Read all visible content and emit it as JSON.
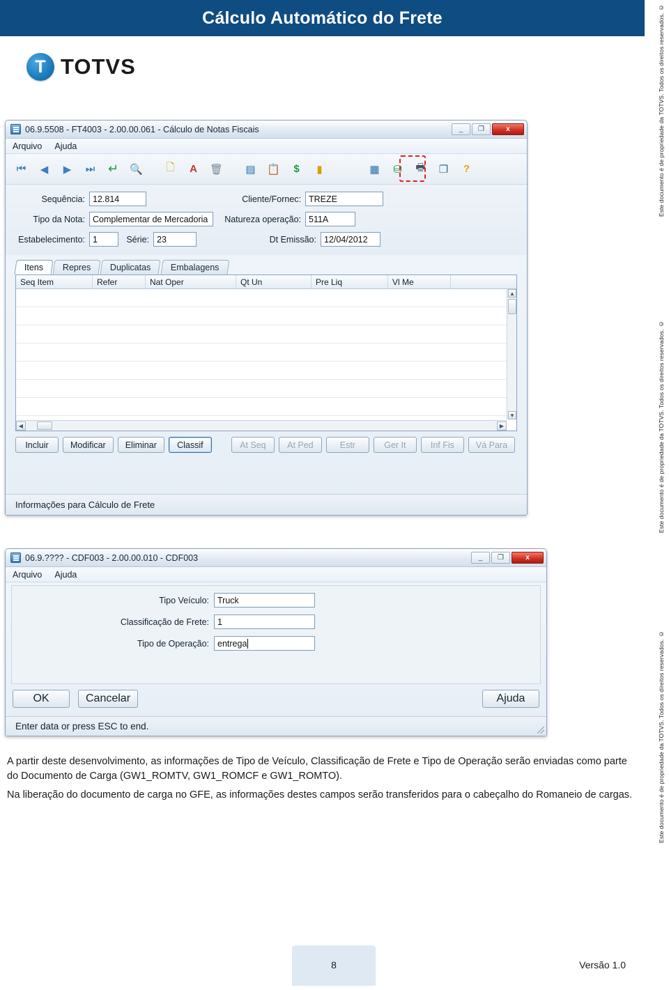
{
  "page": {
    "banner_title": "Cálculo Automático do Frete",
    "banner_color": "#0f4c81",
    "logo_text": "TOTVS",
    "logo_icon": "totvs-t-logo-icon",
    "footer_page_number": "8",
    "footer_version": "Versão 1.0"
  },
  "side_notes": [
    "Este documento é de propriedade da TOTVS. Todos os direitos reservados. ©",
    "Este documento é de propriedade da TOTVS. Todos os direitos reservados. ©",
    "Este documento é de propriedade da TOTVS. Todos os direitos reservados. ©"
  ],
  "window_nf": {
    "title": "06.9.5508 - FT4003 - 2.00.00.061 - Cálculo de Notas Fiscais",
    "window_icon": "application-icon",
    "buttons": {
      "minimize": "_",
      "maximize": "❐",
      "close": "x"
    },
    "menu": [
      "Arquivo",
      "Ajuda"
    ],
    "toolbar": [
      {
        "name": "first-record-button",
        "glyph": "⏮"
      },
      {
        "name": "previous-record-button",
        "glyph": "◀"
      },
      {
        "name": "next-record-button",
        "glyph": "▶"
      },
      {
        "name": "last-record-button",
        "glyph": "⏭"
      },
      {
        "name": "enter-button",
        "glyph": "↵"
      },
      {
        "name": "search-button",
        "glyph": "🔍"
      },
      {
        "name": "new-document-button",
        "glyph": "🗋"
      },
      {
        "name": "text-edit-button",
        "glyph": "A"
      },
      {
        "name": "delete-button",
        "glyph": "🗑"
      },
      {
        "name": "report-button",
        "glyph": "▤"
      },
      {
        "name": "clipboard-button",
        "glyph": "📋"
      },
      {
        "name": "currency-button",
        "glyph": "$"
      },
      {
        "name": "book-button",
        "glyph": "▮"
      },
      {
        "name": "freight-calc-button",
        "glyph": "▦"
      },
      {
        "name": "tree-button",
        "glyph": "⛁"
      },
      {
        "name": "print-button",
        "glyph": "🖶"
      },
      {
        "name": "copy-button",
        "glyph": "❐"
      },
      {
        "name": "help-button",
        "glyph": "?"
      }
    ],
    "fields": [
      {
        "label": "Sequência:",
        "value": "12.814"
      },
      {
        "label": "Cliente/Fornec:",
        "value": "TREZE"
      },
      {
        "label": "Tipo da Nota:",
        "value": "Complementar de Mercadoria"
      },
      {
        "label": "Natureza operação:",
        "value": "511A"
      },
      {
        "label": "Estabelecimento:",
        "value": "1"
      },
      {
        "label": "Série:",
        "value": "23"
      },
      {
        "label": "Dt Emissão:",
        "value": "12/04/2012"
      }
    ],
    "tabs": [
      {
        "label": "Itens",
        "active": true
      },
      {
        "label": "Repres",
        "active": false
      },
      {
        "label": "Duplicatas",
        "active": false
      },
      {
        "label": "Embalagens",
        "active": false
      }
    ],
    "grid_columns": [
      "Seq Item",
      "Refer",
      "Nat Oper",
      "Qt Un",
      "Pre Liq",
      "Vl Me"
    ],
    "grid_rows": [],
    "action_buttons": [
      {
        "label": "Incluir",
        "state": "normal"
      },
      {
        "label": "Modificar",
        "state": "normal"
      },
      {
        "label": "Eliminar",
        "state": "normal"
      },
      {
        "label": "Classif",
        "state": "selected"
      },
      {
        "label": "At Seq",
        "state": "disabled"
      },
      {
        "label": "At Ped",
        "state": "disabled"
      },
      {
        "label": "Estr",
        "state": "disabled"
      },
      {
        "label": "Ger It",
        "state": "disabled"
      },
      {
        "label": "Inf Fis",
        "state": "disabled"
      },
      {
        "label": "Vá Para",
        "state": "disabled"
      }
    ],
    "status_text": "Informações para Cálculo de Frete"
  },
  "window_cdf": {
    "title": "06.9.???? - CDF003 - 2.00.00.010 - CDF003",
    "window_icon": "application-icon",
    "buttons": {
      "minimize": "_",
      "maximize": "❐",
      "close": "x"
    },
    "menu": [
      "Arquivo",
      "Ajuda"
    ],
    "fields": [
      {
        "label": "Tipo Veículo:",
        "value": "Truck"
      },
      {
        "label": "Classificação de Frete:",
        "value": "1"
      },
      {
        "label": "Tipo de Operação:",
        "value": "entrega"
      }
    ],
    "buttons_row": [
      {
        "name": "ok-button",
        "label": "OK"
      },
      {
        "name": "cancel-button",
        "label": "Cancelar"
      },
      {
        "name": "help-button",
        "label": "Ajuda"
      }
    ],
    "status_text": "Enter data or press ESC to end."
  },
  "body": {
    "paragraph1": "A partir deste desenvolvimento, as informações de Tipo de Veículo, Classificação de Frete e Tipo de Operação serão enviadas como parte do Documento de Carga (GW1_ROMTV, GW1_ROMCF e GW1_ROMTO).",
    "paragraph2": "Na liberação do documento de carga no GFE, as informações destes campos serão transferidos para o cabeçalho do Romaneio de cargas."
  }
}
